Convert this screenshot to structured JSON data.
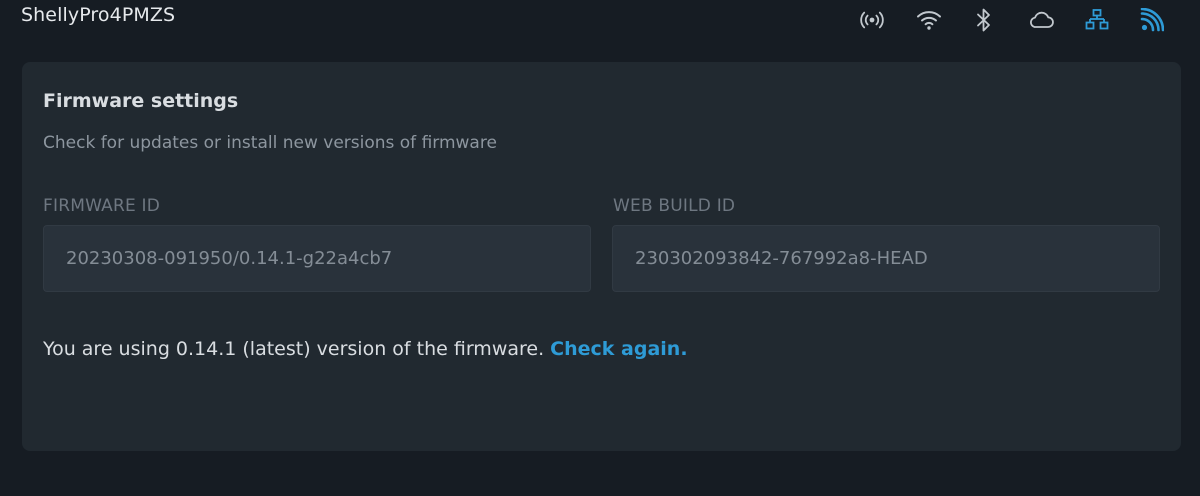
{
  "header": {
    "device_name": "ShellyPro4PMZS",
    "icons": [
      {
        "name": "signal-broadcast-icon",
        "color": "#c2c8ce"
      },
      {
        "name": "wifi-icon",
        "color": "#c2c8ce"
      },
      {
        "name": "bluetooth-icon",
        "color": "#c2c8ce"
      },
      {
        "name": "cloud-icon",
        "color": "#c2c8ce"
      },
      {
        "name": "ethernet-network-icon",
        "color": "#2e9bd6"
      },
      {
        "name": "rss-feed-icon",
        "color": "#2e9bd6"
      }
    ]
  },
  "firmware": {
    "title": "Firmware settings",
    "subtitle": "Check for updates or install new versions of firmware",
    "firmware_id_label": "FIRMWARE ID",
    "firmware_id_value": "20230308-091950/0.14.1-g22a4cb7",
    "web_build_id_label": "WEB BUILD ID",
    "web_build_id_value": "230302093842-767992a8-HEAD",
    "status_text": "You are using 0.14.1 (latest) version of the firmware.",
    "check_again_label": "Check again."
  },
  "colors": {
    "background": "#161c23",
    "card": "#212930",
    "accent": "#2e9bd6"
  }
}
